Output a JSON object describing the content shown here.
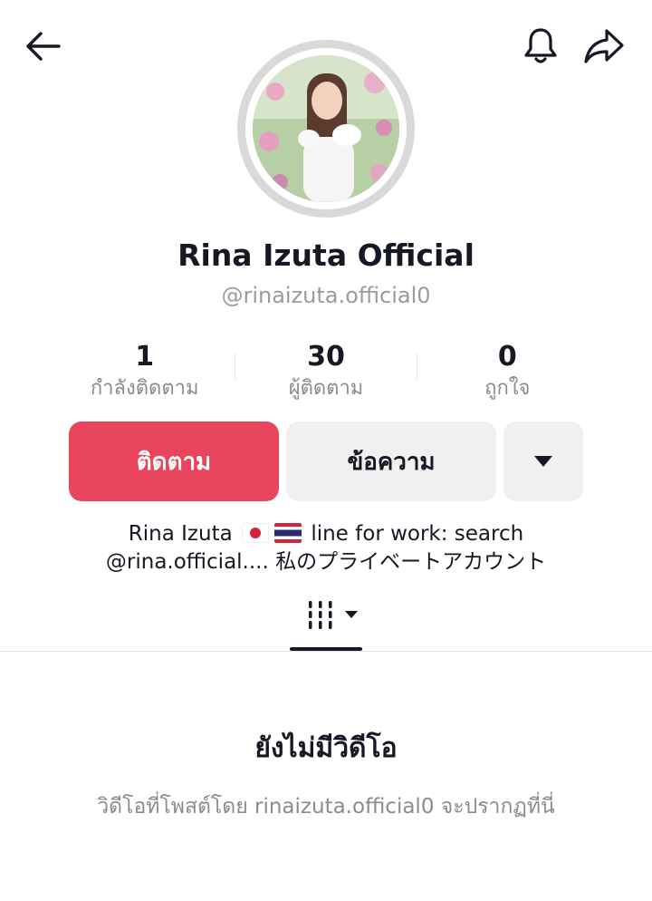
{
  "header": {
    "back_icon": "arrow-left-icon",
    "bell_icon": "bell-icon",
    "share_icon": "share-arrow-icon"
  },
  "profile": {
    "display_name": "Rina Izuta Official",
    "username": "@rinaizuta.official0"
  },
  "stats": [
    {
      "value": "1",
      "label": "กำลังติดตาม"
    },
    {
      "value": "30",
      "label": "ผู้ติดตาม"
    },
    {
      "value": "0",
      "label": "ถูกใจ"
    }
  ],
  "actions": {
    "follow_label": "ติดตาม",
    "message_label": "ข้อความ",
    "more_icon": "caret-down-icon"
  },
  "bio": {
    "part1": "Rina Izuta",
    "part2": "line for work: search",
    "line2": "@rina.official.... 私のプライベートアカウント",
    "flags": [
      "japan-flag",
      "thailand-flag"
    ]
  },
  "tabs": {
    "videos_icon": "grid-icon"
  },
  "empty_state": {
    "title": "ยังไม่มีวิดีโอ",
    "subtitle": "วิดีโอที่โพสต์โดย rinaizuta.official0 จะปรากฏที่นี่"
  },
  "colors": {
    "follow_button": "#e8465c",
    "secondary_button": "#f0f0f1",
    "muted_text": "#8a8b91"
  }
}
